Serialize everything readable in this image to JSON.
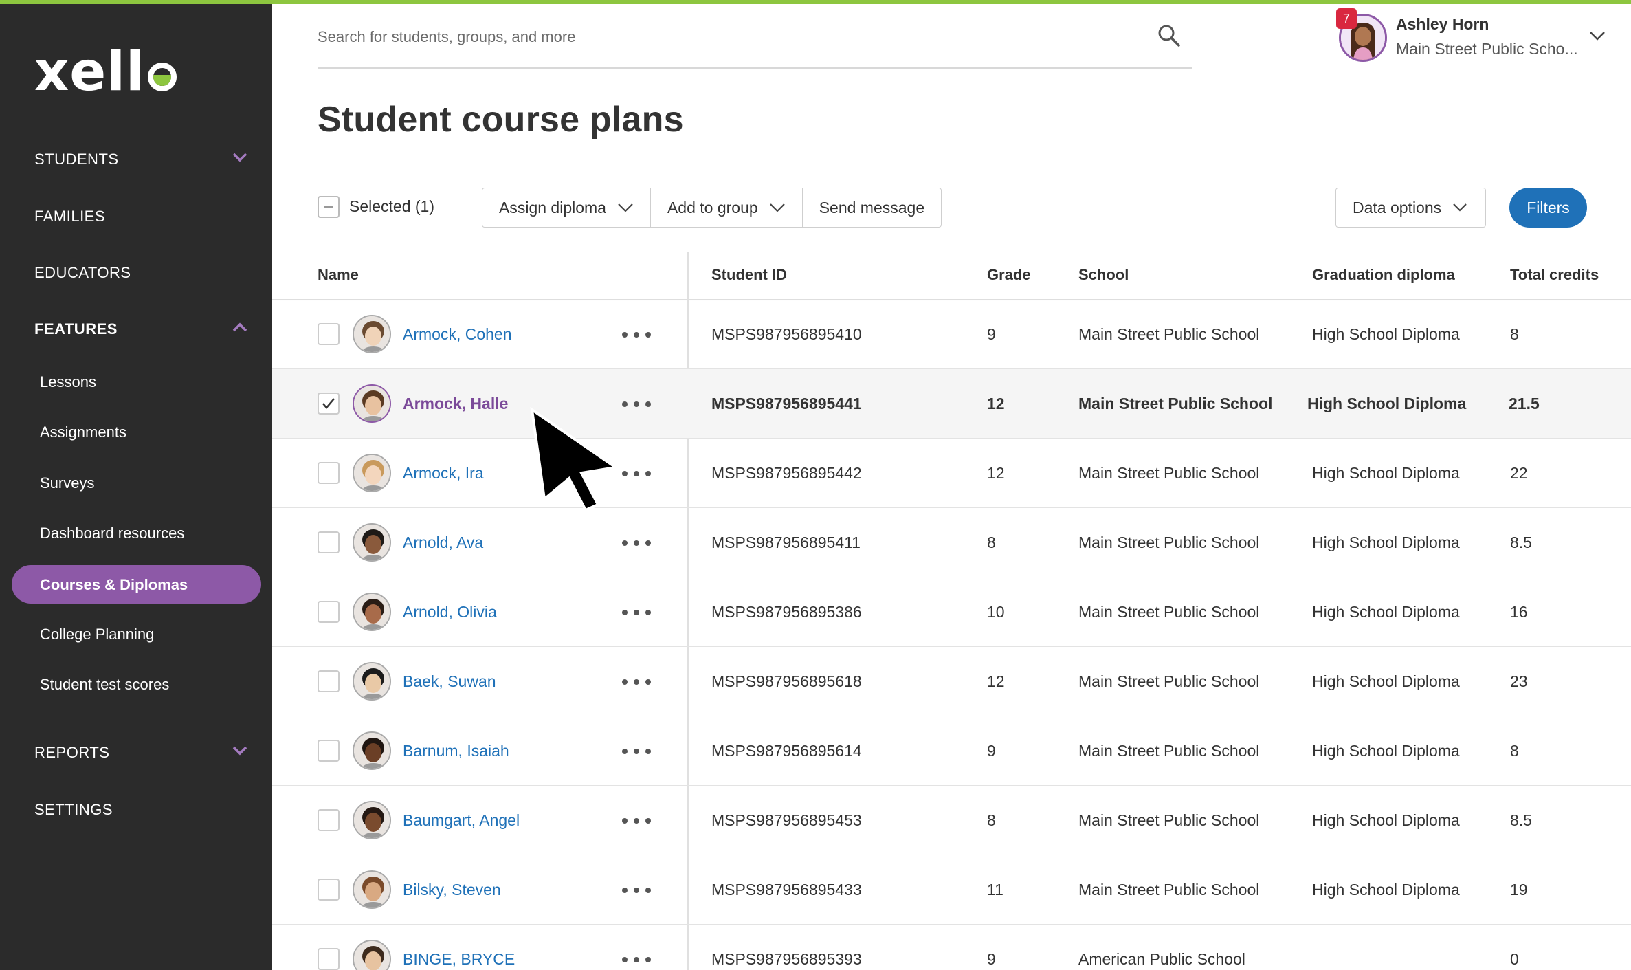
{
  "brand": {
    "logo_text": "xello",
    "accent": "#8dc63f",
    "purple": "#8d59a7",
    "blue": "#1f71b8"
  },
  "sidebar": {
    "top_items": [
      {
        "label": "STUDENTS",
        "icon": "chevron-down-icon"
      },
      {
        "label": "FAMILIES"
      },
      {
        "label": "EDUCATORS"
      },
      {
        "label": "FEATURES",
        "icon": "chevron-up-icon",
        "expanded": true
      }
    ],
    "feature_items": [
      "Lessons",
      "Assignments",
      "Surveys",
      "Dashboard resources",
      "Courses & Diplomas",
      "College Planning",
      "Student test scores"
    ],
    "active_item": "Courses & Diplomas",
    "bottom_items": [
      {
        "label": "REPORTS",
        "icon": "chevron-down-icon"
      },
      {
        "label": "SETTINGS"
      }
    ]
  },
  "header": {
    "search_placeholder": "Search for students, groups, and more",
    "user": {
      "name": "Ashley Horn",
      "school": "Main Street Public Scho...",
      "notification_count": "7"
    }
  },
  "page": {
    "title": "Student course plans"
  },
  "toolbar": {
    "selected_label": "Selected (1)",
    "assign_diploma": "Assign diploma",
    "add_to_group": "Add to group",
    "send_message": "Send message",
    "data_options": "Data options",
    "filters": "Filters"
  },
  "table": {
    "columns": [
      "Name",
      "Student ID",
      "Grade",
      "School",
      "Graduation diploma",
      "Total credits"
    ],
    "rows": [
      {
        "name": "Armock, Cohen",
        "id": "MSPS987956895410",
        "grade": "9",
        "school": "Main Street Public School",
        "diploma": "High School Diploma",
        "credits": "8",
        "selected": false
      },
      {
        "name": "Armock, Halle",
        "id": "MSPS987956895441",
        "grade": "12",
        "school": "Main Street Public School",
        "diploma": "High School Diploma",
        "credits": "21.5",
        "selected": true
      },
      {
        "name": "Armock, Ira",
        "id": "MSPS987956895442",
        "grade": "12",
        "school": "Main Street Public School",
        "diploma": "High School Diploma",
        "credits": "22",
        "selected": false
      },
      {
        "name": "Arnold, Ava",
        "id": "MSPS987956895411",
        "grade": "8",
        "school": "Main Street Public School",
        "diploma": "High School Diploma",
        "credits": "8.5",
        "selected": false
      },
      {
        "name": "Arnold, Olivia",
        "id": "MSPS987956895386",
        "grade": "10",
        "school": "Main Street Public School",
        "diploma": "High School Diploma",
        "credits": "16",
        "selected": false
      },
      {
        "name": "Baek, Suwan",
        "id": "MSPS987956895618",
        "grade": "12",
        "school": "Main Street Public School",
        "diploma": "High School Diploma",
        "credits": "23",
        "selected": false
      },
      {
        "name": "Barnum, Isaiah",
        "id": "MSPS987956895614",
        "grade": "9",
        "school": "Main Street Public School",
        "diploma": "High School Diploma",
        "credits": "8",
        "selected": false
      },
      {
        "name": "Baumgart, Angel",
        "id": "MSPS987956895453",
        "grade": "8",
        "school": "Main Street Public School",
        "diploma": "High School Diploma",
        "credits": "8.5",
        "selected": false
      },
      {
        "name": "Bilsky, Steven",
        "id": "MSPS987956895433",
        "grade": "11",
        "school": "Main Street Public School",
        "diploma": "High School Diploma",
        "credits": "19",
        "selected": false
      },
      {
        "name": "BINGE, BRYCE",
        "id": "MSPS987956895393",
        "grade": "9",
        "school": "American Public School",
        "diploma": "",
        "credits": "0",
        "selected": false
      }
    ]
  }
}
